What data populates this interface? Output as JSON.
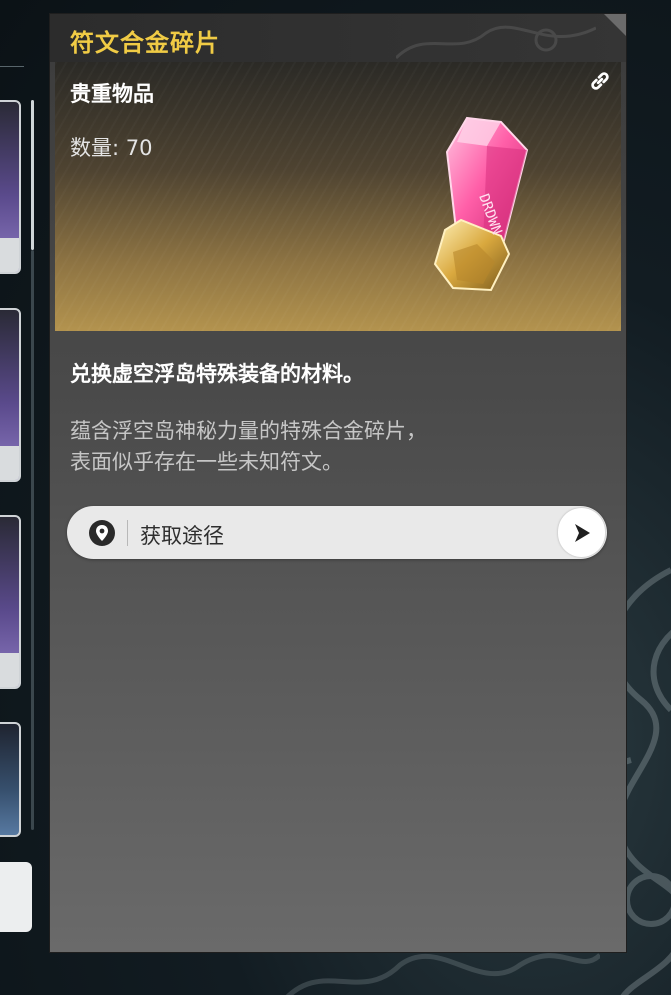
{
  "item": {
    "name": "符文合金碎片",
    "rarity": "贵重物品",
    "count_text": "数量: 70",
    "summary": "兑换虚空浮岛特殊装备的材料。",
    "description_lines": [
      "蕴含浮空岛神秘力量的特殊合金碎片，",
      "表面似乎存在一些未知符文。"
    ],
    "crystal_runes": "DRDWN",
    "icons": {
      "link": "link-icon",
      "pin": "location-pin-icon",
      "arrow": "arrow-right-icon"
    }
  },
  "obtain": {
    "label": "获取途径"
  },
  "colors": {
    "title": "#f0cb45",
    "card_gold": "#b3934e",
    "crystal_pink": "#ff5fa8",
    "obtain_bg": "#e9e9e9"
  }
}
